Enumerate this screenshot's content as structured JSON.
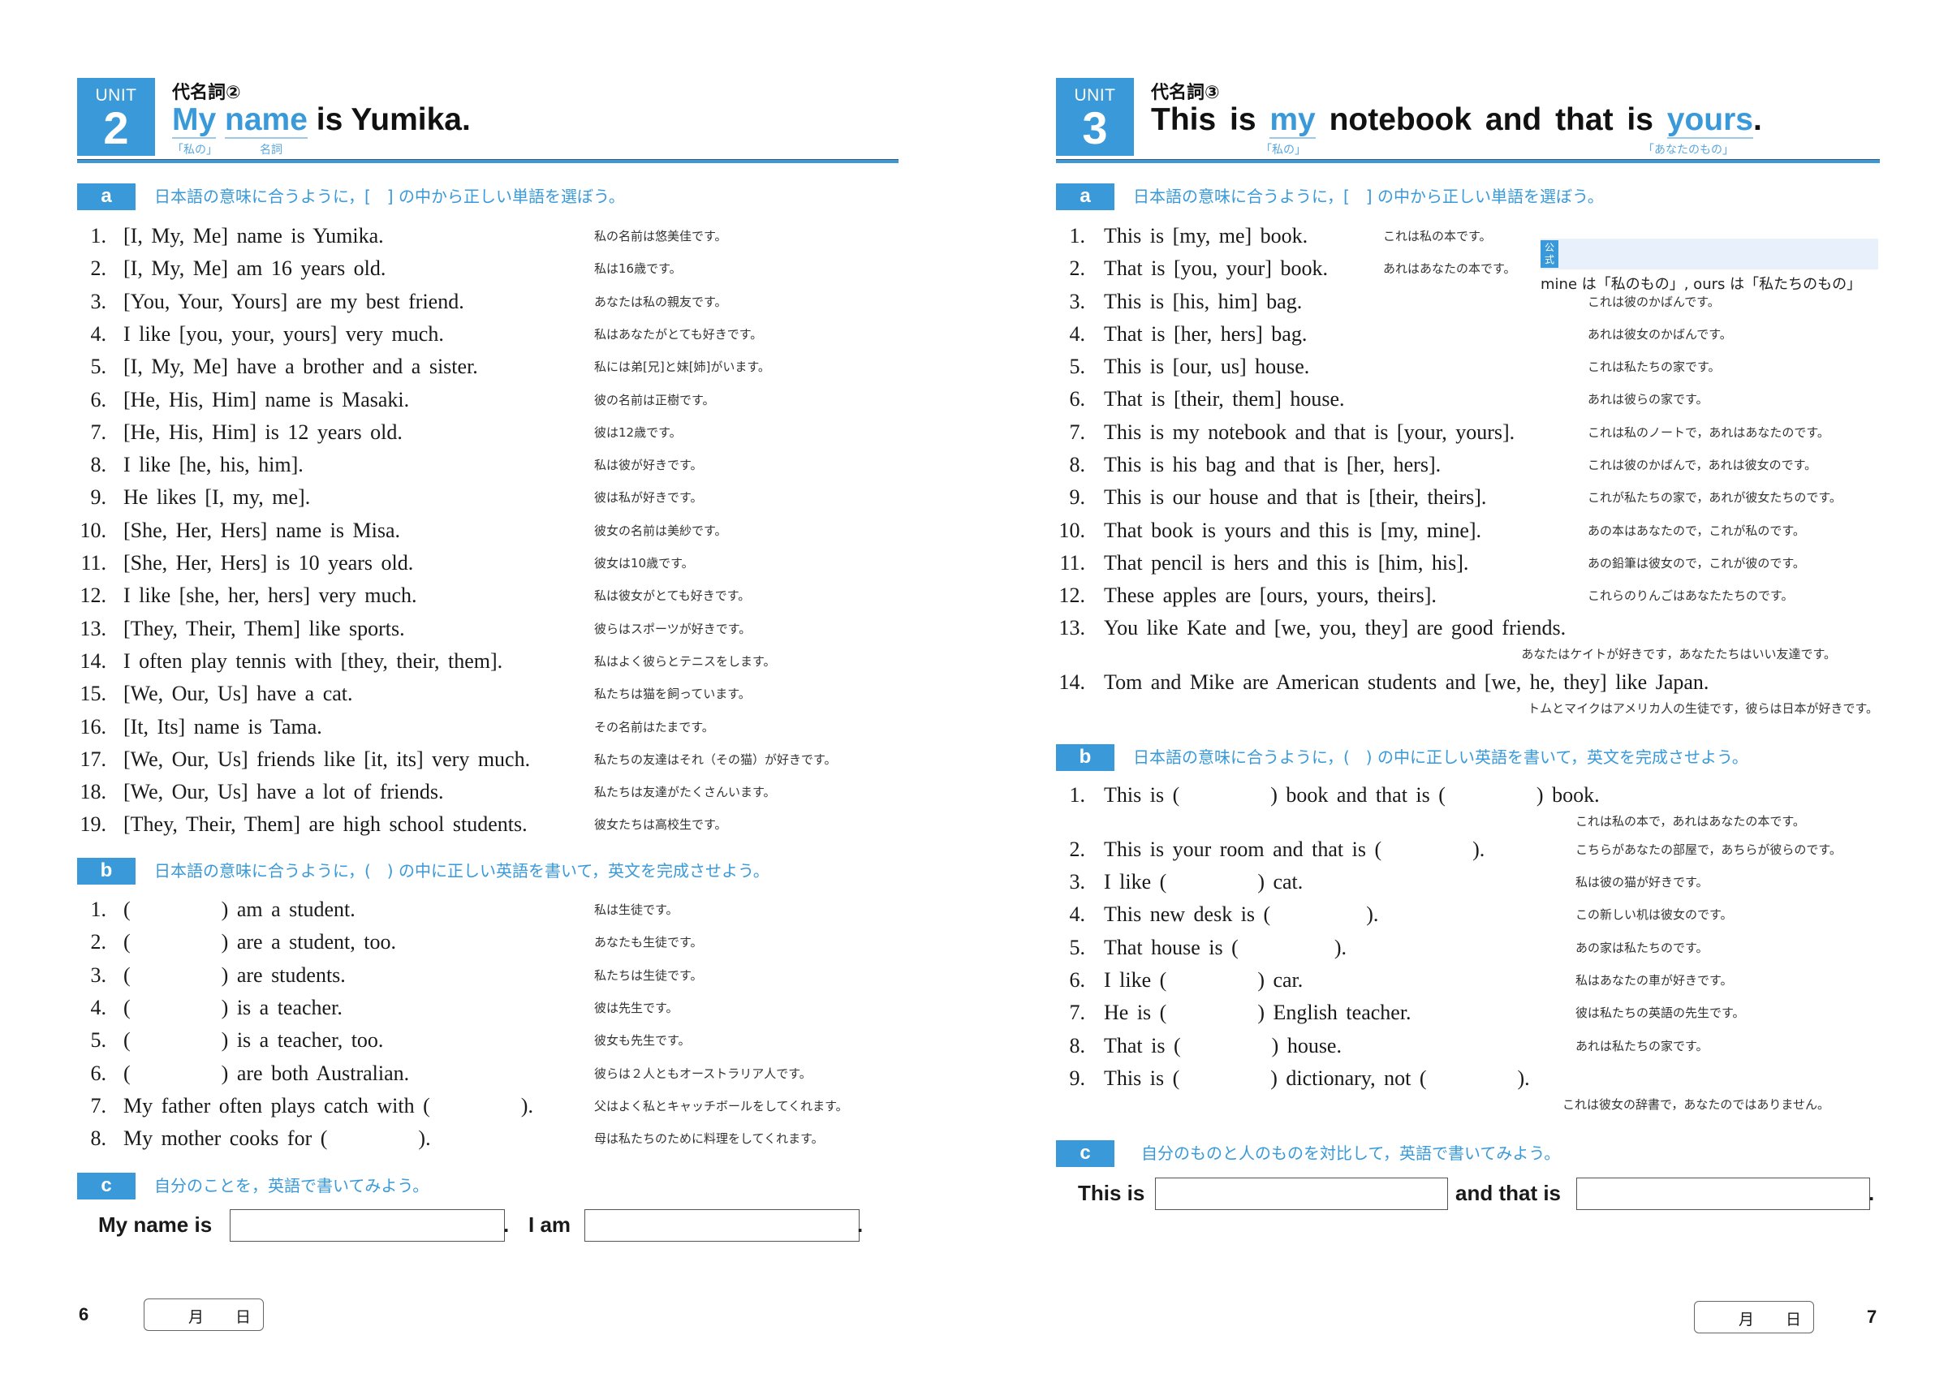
{
  "left_page": {
    "unit": {
      "label": "UNIT",
      "number": "2"
    },
    "topic": "代名詞②",
    "title": {
      "part1": "My",
      "part2": "name",
      "rest": " is Yumika.",
      "gloss1": "「私の」",
      "gloss2": "名詞"
    },
    "section_a": {
      "badge": "a",
      "instruction": "日本語の意味に合うように，[　] の中から正しい単語を選ぼう。",
      "items": [
        {
          "num": "1.",
          "en": "[I, My, Me] name is Yumika.",
          "jp": "私の名前は悠美佳です。"
        },
        {
          "num": "2.",
          "en": "[I, My, Me] am 16 years old.",
          "jp": "私は16歳です。"
        },
        {
          "num": "3.",
          "en": "[You, Your, Yours] are my best friend.",
          "jp": "あなたは私の親友です。"
        },
        {
          "num": "4.",
          "en": "I like [you, your, yours] very much.",
          "jp": "私はあなたがとても好きです。"
        },
        {
          "num": "5.",
          "en": "[I, My, Me] have a brother and a sister.",
          "jp": "私には弟[兄]と妹[姉]がいます。"
        },
        {
          "num": "6.",
          "en": "[He, His, Him] name is Masaki.",
          "jp": "彼の名前は正樹です。"
        },
        {
          "num": "7.",
          "en": "[He, His, Him] is 12 years old.",
          "jp": "彼は12歳です。"
        },
        {
          "num": "8.",
          "en": "I like [he, his, him].",
          "jp": "私は彼が好きです。"
        },
        {
          "num": "9.",
          "en": "He likes [I, my, me].",
          "jp": "彼は私が好きです。"
        },
        {
          "num": "10.",
          "en": "[She, Her, Hers] name is Misa.",
          "jp": "彼女の名前は美紗です。"
        },
        {
          "num": "11.",
          "en": "[She, Her, Hers] is 10 years old.",
          "jp": "彼女は10歳です。"
        },
        {
          "num": "12.",
          "en": "I like [she, her, hers] very much.",
          "jp": "私は彼女がとても好きです。"
        },
        {
          "num": "13.",
          "en": "[They, Their, Them] like sports.",
          "jp": "彼らはスポーツが好きです。"
        },
        {
          "num": "14.",
          "en": "I often play tennis with [they, their, them].",
          "jp": "私はよく彼らとテニスをします。"
        },
        {
          "num": "15.",
          "en": "[We, Our, Us] have a cat.",
          "jp": "私たちは猫を飼っています。"
        },
        {
          "num": "16.",
          "en": "[It, Its] name is Tama.",
          "jp": "その名前はたまです。"
        },
        {
          "num": "17.",
          "en": "[We, Our, Us] friends like [it, its] very much.",
          "jp": "私たちの友達はそれ（その猫）が好きです。"
        },
        {
          "num": "18.",
          "en": "[We, Our, Us] have a lot of friends.",
          "jp": "私たちは友達がたくさんいます。"
        },
        {
          "num": "19.",
          "en": "[They, Their, Them] are high school students.",
          "jp": "彼女たちは高校生です。"
        }
      ]
    },
    "section_b": {
      "badge": "b",
      "instruction": "日本語の意味に合うように，(　) の中に正しい英語を書いて，英文を完成させよう。",
      "items": [
        {
          "num": "1.",
          "pre": "(",
          "post": ") am a student.",
          "jp": "私は生徒です。"
        },
        {
          "num": "2.",
          "pre": "(",
          "post": ") are a student, too.",
          "jp": "あなたも生徒です。"
        },
        {
          "num": "3.",
          "pre": "(",
          "post": ") are students.",
          "jp": "私たちは生徒です。"
        },
        {
          "num": "4.",
          "pre": "(",
          "post": ") is a teacher.",
          "jp": "彼は先生です。"
        },
        {
          "num": "5.",
          "pre": "(",
          "post": ") is a teacher, too.",
          "jp": "彼女も先生です。"
        },
        {
          "num": "6.",
          "pre": "(",
          "post": ") are both Australian.",
          "jp": "彼らは２人ともオーストラリア人です。"
        },
        {
          "num": "7.",
          "pre": "My father often plays catch with (",
          "post": ").",
          "jp": "父はよく私とキャッチボールをしてくれます。"
        },
        {
          "num": "8.",
          "pre": "My mother cooks for (",
          "post": ").",
          "jp": "母は私たちのために料理をしてくれます。"
        }
      ]
    },
    "section_c": {
      "badge": "c",
      "instruction": "自分のことを，英語で書いてみよう。",
      "label1": "My name is",
      "label2": "I am",
      "period": ".",
      "input1_value": "",
      "input2_value": ""
    },
    "page_number": "6",
    "date_box": {
      "month": "月",
      "day": "日"
    }
  },
  "right_page": {
    "unit": {
      "label": "UNIT",
      "number": "3"
    },
    "topic": "代名詞③",
    "title": {
      "pre": "This is ",
      "hl1": "my",
      "mid": " notebook and that is ",
      "hl2": "yours",
      "end": ".",
      "gloss1": "「私の」",
      "gloss2": "「あなたのもの」"
    },
    "tip": {
      "tag": "公式",
      "text": "mine は「私のもの」, ours は「私たちのもの」"
    },
    "section_a": {
      "badge": "a",
      "instruction": "日本語の意味に合うように，[　] の中から正しい単語を選ぼう。",
      "items": [
        {
          "num": "1.",
          "en": "This is [my, me] book.",
          "jp": "これは私の本です。"
        },
        {
          "num": "2.",
          "en": "That is [you, your] book.",
          "jp": "あれはあなたの本です。"
        },
        {
          "num": "3.",
          "en": "This is [his, him] bag.",
          "jp": "これは彼のかばんです。"
        },
        {
          "num": "4.",
          "en": "That is [her, hers] bag.",
          "jp": "あれは彼女のかばんです。"
        },
        {
          "num": "5.",
          "en": "This is [our, us] house.",
          "jp": "これは私たちの家です。"
        },
        {
          "num": "6.",
          "en": "That is [their, them] house.",
          "jp": "あれは彼らの家です。"
        },
        {
          "num": "7.",
          "en": "This is my notebook and that is [your, yours].",
          "jp": "これは私のノートで，あれはあなたのです。"
        },
        {
          "num": "8.",
          "en": "This is his bag and that is [her, hers].",
          "jp": "これは彼のかばんで，あれは彼女のです。"
        },
        {
          "num": "9.",
          "en": "This is our house and that is [their, theirs].",
          "jp": "これが私たちの家で，あれが彼女たちのです。"
        },
        {
          "num": "10.",
          "en": "That book is yours and this is [my, mine].",
          "jp": "あの本はあなたので，これが私のです。"
        },
        {
          "num": "11.",
          "en": "That pencil is hers and this is [him, his].",
          "jp": "あの鉛筆は彼女ので，これが彼のです。"
        },
        {
          "num": "12.",
          "en": "These apples are [ours, yours, theirs].",
          "jp": "これらのりんごはあなたたちのです。"
        },
        {
          "num": "13.",
          "en": "You like Kate and [we, you, they] are good friends.",
          "jp": "あなたはケイトが好きです，あなたたちはいい友達です。"
        },
        {
          "num": "14.",
          "en": "Tom and Mike are American students and [we, he, they] like Japan.",
          "jp": "トムとマイクはアメリカ人の生徒です，彼らは日本が好きです。"
        }
      ]
    },
    "section_b": {
      "badge": "b",
      "instruction": "日本語の意味に合うように，(　) の中に正しい英語を書いて，英文を完成させよう。",
      "items": [
        {
          "num": "1.",
          "parts": [
            "This is (",
            ") book and that is (",
            ") book."
          ],
          "jp": "これは私の本で，あれはあなたの本です。"
        },
        {
          "num": "2.",
          "parts": [
            "This is your room and that is (",
            ")."
          ],
          "jp": "こちらがあなたの部屋で，あちらが彼らのです。"
        },
        {
          "num": "3.",
          "parts": [
            "I like (",
            ") cat."
          ],
          "jp": "私は彼の猫が好きです。"
        },
        {
          "num": "4.",
          "parts": [
            "This new desk is (",
            ")."
          ],
          "jp": "この新しい机は彼女のです。"
        },
        {
          "num": "5.",
          "parts": [
            "That house is (",
            ")."
          ],
          "jp": "あの家は私たちのです。"
        },
        {
          "num": "6.",
          "parts": [
            "I like (",
            ") car."
          ],
          "jp": "私はあなたの車が好きです。"
        },
        {
          "num": "7.",
          "parts": [
            "He is (",
            ") English teacher."
          ],
          "jp": "彼は私たちの英語の先生です。"
        },
        {
          "num": "8.",
          "parts": [
            "That is (",
            ") house."
          ],
          "jp": "あれは私たちの家です。"
        },
        {
          "num": "9.",
          "parts": [
            "This is (",
            ") dictionary, not (",
            ")."
          ],
          "jp": "これは彼女の辞書で，あなたのではありません。"
        }
      ]
    },
    "section_c": {
      "badge": "c",
      "instruction": "自分のものと人のものを対比して，英語で書いてみよう。",
      "label1": "This is",
      "label2": "and that is",
      "period": ".",
      "input1_value": "",
      "input2_value": ""
    },
    "page_number": "7",
    "date_box": {
      "month": "月",
      "day": "日"
    }
  },
  "colors": {
    "accent": "#3a9ad9",
    "tip_bg": "#e8f1fb",
    "text": "#1a1a1a"
  }
}
